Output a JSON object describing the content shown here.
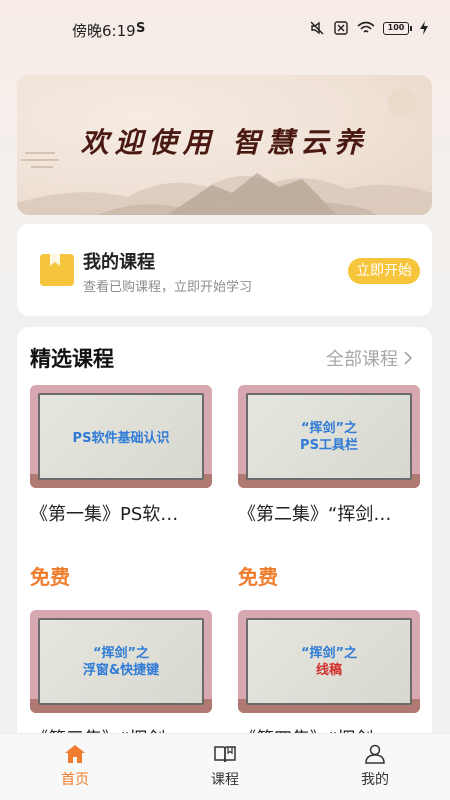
{
  "status_bar": {
    "time": "傍晚6:19",
    "carrier_icon": "sync-s-icon",
    "battery": "100"
  },
  "banner": {
    "title": "欢迎使用 智慧云养"
  },
  "my_courses": {
    "title": "我的课程",
    "subtitle": "查看已购课程，立即开始学习",
    "start_label": "立即开始"
  },
  "featured": {
    "title": "精选课程",
    "all_label": "全部课程",
    "courses": [
      {
        "thumb_line1": "PS软件基础认识",
        "thumb_line2": "",
        "title": "《第一集》PS软…",
        "free": ""
      },
      {
        "thumb_line1": "“挥剑”之",
        "thumb_line2": "PS工具栏",
        "title": "《第二集》“挥剑…",
        "free": ""
      },
      {
        "thumb_line1": "“挥剑”之",
        "thumb_line2": "浮窗&快捷键",
        "title": "《第三集》“挥剑…",
        "free": "免费"
      },
      {
        "thumb_line1": "“挥剑”之",
        "thumb_line2": "线稿",
        "title": "《第四集》“挥剑…",
        "free": "免费"
      }
    ]
  },
  "bottom_nav": {
    "items": [
      {
        "label": "首页",
        "icon": "home-icon"
      },
      {
        "label": "课程",
        "icon": "book-open-icon"
      },
      {
        "label": "我的",
        "icon": "person-icon"
      }
    ],
    "active_color": "#f07d2d"
  }
}
